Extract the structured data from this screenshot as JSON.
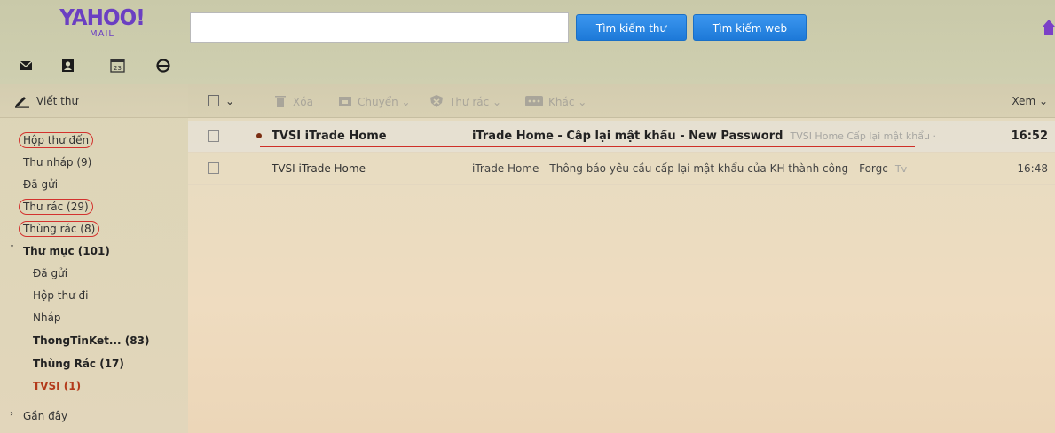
{
  "logo": {
    "big": "YAHOO!",
    "small": "MAIL"
  },
  "search": {
    "placeholder": "",
    "value": ""
  },
  "buttons": {
    "search_mail": "Tìm kiếm thư",
    "search_web": "Tìm kiếm web"
  },
  "compose": {
    "label": "Viết thư"
  },
  "folders": {
    "inbox": "Hộp thư đến",
    "drafts": "Thư nháp (9)",
    "sent": "Đã gửi",
    "spam": "Thư rác (29)",
    "trash": "Thùng rác (8)",
    "my_folders": "Thư mục (101)",
    "sub": {
      "sent": "Đã gửi",
      "outbox": "Hộp thư đi",
      "draft": "Nháp",
      "thongtin": "ThongTinKet... (83)",
      "thungrac": "Thùng Rác (17)",
      "tvsi": "TVSI (1)"
    },
    "recent": "Gần đây"
  },
  "toolbar": {
    "delete": "Xóa",
    "move": "Chuyển ⌄",
    "spam": "Thư rác ⌄",
    "more": "Khác ⌄",
    "view": "Xem ⌄",
    "select_caret": "⌄"
  },
  "messages": [
    {
      "sender": "TVSI iTrade Home",
      "subject": "iTrade Home - Cấp lại mật khẩu - New Password",
      "snippet": "TVSI Home Cấp lại mật khẩu ·",
      "time": "16:52",
      "unread": true
    },
    {
      "sender": "TVSI iTrade Home",
      "subject": "iTrade Home - Thông báo yêu cầu cấp lại mật khẩu của KH thành công - Forgc",
      "snippet": "Tv",
      "time": "16:48",
      "unread": false
    }
  ],
  "colors": {
    "accent": "#1d79d8",
    "brand": "#6b3fc2",
    "highlight": "#d3322e"
  }
}
